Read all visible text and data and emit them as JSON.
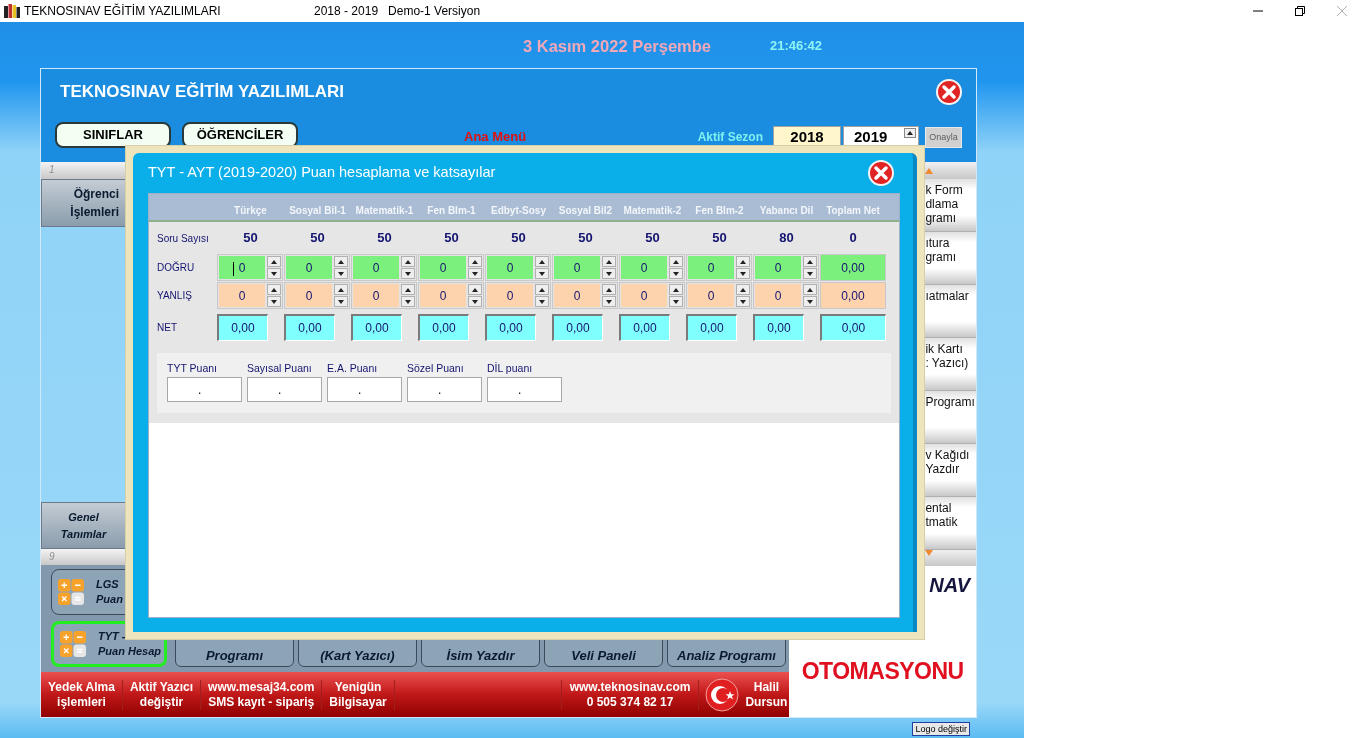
{
  "titlebar": {
    "app_title": "TEKNOSINAV EĞİTİM YAZILIMLARI",
    "version": "2018 - 2019   Demo-1 Versiyon"
  },
  "header": {
    "date": "3 Kasım 2022 Perşembe",
    "time": "21:46:42"
  },
  "main_window": {
    "title": "TEKNOSINAV EĞİTİM YAZILIMLARI",
    "nav_buttons": [
      "SINIFLAR",
      "ÖĞRENCİLER"
    ],
    "menu_label": "Ana Menü",
    "season": {
      "label": "Aktif Sezon",
      "start": "2018",
      "end": "2019",
      "confirm": "Onayla"
    }
  },
  "sidebar": {
    "top_strip": "1",
    "top_tile": [
      "Öğrenci",
      "İşlemleri"
    ],
    "bottom_tile": [
      "Genel",
      "Tanımlar"
    ],
    "bottom_strip": "9"
  },
  "calc_buttons": [
    {
      "lines": [
        "LGS",
        "Puan"
      ],
      "selected": false
    },
    {
      "lines": [
        "TYT -",
        "Puan Hesap"
      ],
      "selected": true
    }
  ],
  "bottom_buttons": [
    "Programı",
    "(Kart Yazıcı)",
    "İsim Yazdır",
    "Veli Paneli",
    "Analiz Programı"
  ],
  "footer": {
    "links": [
      {
        "lines": [
          "Yedek Alma",
          "işlemleri"
        ]
      },
      {
        "lines": [
          "Aktif Yazıcı",
          "değiştir"
        ]
      },
      {
        "lines": [
          "www.mesaj34.com",
          "SMS kayıt - sipariş"
        ]
      },
      {
        "lines": [
          "Yenigün",
          "Bilgisayar"
        ]
      }
    ],
    "contact": [
      "www.teknosinav.com",
      "0 505 374 82 17"
    ],
    "author": [
      "Halil",
      "Dursun"
    ]
  },
  "right_tiles": [
    {
      "lines": [
        "k Form",
        "dlama",
        "gramı"
      ]
    },
    {
      "lines": [
        "ıtura",
        "gramı"
      ]
    },
    {
      "lines": [
        "ıatmalar"
      ]
    },
    {
      "lines": [
        "ik Kartı",
        ": Yazıcı)"
      ]
    },
    {
      "lines": [
        "Programı"
      ]
    },
    {
      "lines": [
        "v Kağıdı",
        "Yazdır"
      ]
    },
    {
      "lines": [
        "ental",
        "tmatik"
      ]
    }
  ],
  "logo": {
    "brand": "NAV",
    "tagline": "OTOMASYONU",
    "change_button": "Logo değiştir"
  },
  "dialog": {
    "title": "TYT - AYT (2019-2020) Puan hesaplama ve katsayılar",
    "row_labels": [
      "Soru Sayısı",
      "DOĞRU",
      "YANLIŞ",
      "NET"
    ],
    "columns": [
      {
        "kind": "subject",
        "name": "Türkçe",
        "questions": "50",
        "correct": "0",
        "wrong": "0",
        "net": "0,00",
        "focused": true
      },
      {
        "kind": "subject",
        "name": "Sosyal Bil-1",
        "questions": "50",
        "correct": "0",
        "wrong": "0",
        "net": "0,00",
        "focused": false
      },
      {
        "kind": "subject",
        "name": "Matematik-1",
        "questions": "50",
        "correct": "0",
        "wrong": "0",
        "net": "0,00",
        "focused": false
      },
      {
        "kind": "subject",
        "name": "Fen Blm-1",
        "questions": "50",
        "correct": "0",
        "wrong": "0",
        "net": "0,00",
        "focused": false
      },
      {
        "kind": "subject",
        "name": "Edbyt-Sosy",
        "questions": "50",
        "correct": "0",
        "wrong": "0",
        "net": "0,00",
        "focused": false
      },
      {
        "kind": "subject",
        "name": "Sosyal Bil2",
        "questions": "50",
        "correct": "0",
        "wrong": "0",
        "net": "0,00",
        "focused": false
      },
      {
        "kind": "subject",
        "name": "Matematik-2",
        "questions": "50",
        "correct": "0",
        "wrong": "0",
        "net": "0,00",
        "focused": false
      },
      {
        "kind": "subject",
        "name": "Fen Blm-2",
        "questions": "50",
        "correct": "0",
        "wrong": "0",
        "net": "0,00",
        "focused": false
      },
      {
        "kind": "subject",
        "name": "Yabancı Dil",
        "questions": "80",
        "correct": "0",
        "wrong": "0",
        "net": "0,00",
        "focused": false
      },
      {
        "kind": "total",
        "name": "Toplam Net",
        "questions": "0",
        "correct": "0,00",
        "wrong": "0,00",
        "net": "0,00"
      }
    ],
    "scores": [
      {
        "label": "TYT Puanı",
        "value": "."
      },
      {
        "label": "Sayısal Puanı",
        "value": "."
      },
      {
        "label": "E.A. Puanı",
        "value": "."
      },
      {
        "label": "Sözel Puanı",
        "value": "."
      },
      {
        "label": "DİL puanı",
        "value": "."
      }
    ]
  }
}
